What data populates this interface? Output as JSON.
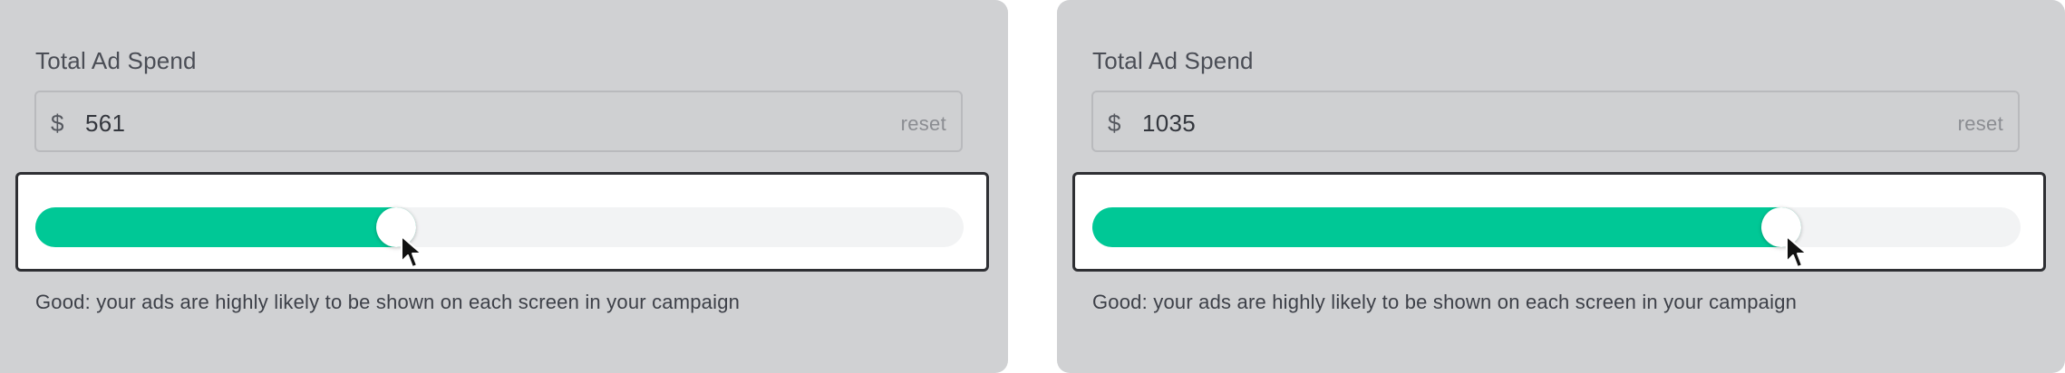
{
  "colors": {
    "panel_bg": "#d0d1d3",
    "fill": "#00c896",
    "track": "#f2f3f4",
    "slider_border": "#2e2f33"
  },
  "panels": [
    {
      "title": "Total Ad Spend",
      "currency_symbol": "$",
      "amount": "561",
      "reset_label": "reset",
      "slider_fraction": 0.389,
      "hint": "Good: your ads are highly likely to be shown on each screen in your campaign",
      "cursor_icon": "mouse-pointer-icon"
    },
    {
      "title": "Total Ad Spend",
      "currency_symbol": "$",
      "amount": "1035",
      "reset_label": "reset",
      "slider_fraction": 0.742,
      "hint": "Good: your ads are highly likely to be shown on each screen in your campaign",
      "cursor_icon": "mouse-pointer-icon"
    }
  ]
}
